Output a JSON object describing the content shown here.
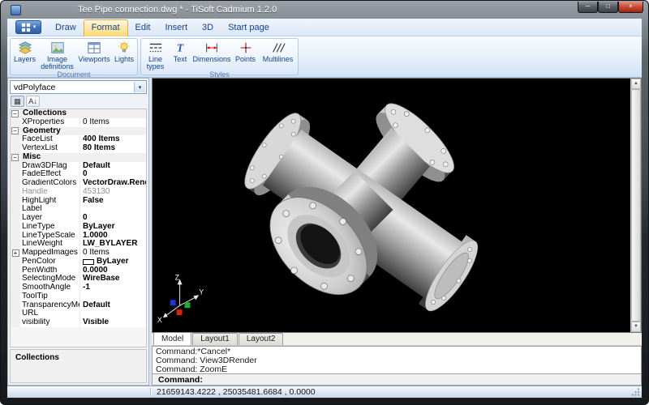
{
  "window": {
    "title": "Tee Pipe connection.dwg * - TiSoft Cadmium 1.2.0",
    "caption_buttons": {
      "minimize": "─",
      "maximize": "□",
      "close": "×"
    }
  },
  "icons": {
    "app_menu_arrow": "▾",
    "combo_arrow": "▾",
    "collapse_glyph": "−",
    "expand_glyph": "+",
    "scroll_up": "▲",
    "scroll_down": "▼",
    "categorized_tool": "▦",
    "alphabetical_tool": "A↓"
  },
  "ribbon": {
    "tabs": [
      {
        "label": "Draw"
      },
      {
        "label": "Format"
      },
      {
        "label": "Edit"
      },
      {
        "label": "Insert"
      },
      {
        "label": "3D"
      },
      {
        "label": "Start page"
      }
    ],
    "active_tab": "Format",
    "groups": [
      {
        "label": "Document",
        "buttons": [
          {
            "label": "Layers",
            "icon": "layers-icon"
          },
          {
            "label": "Image definitions",
            "icon": "image-definitions-icon"
          },
          {
            "label": "Viewports",
            "icon": "viewports-icon"
          },
          {
            "label": "Lights",
            "icon": "lights-icon"
          }
        ]
      },
      {
        "label": "Styles",
        "buttons": [
          {
            "label": "Line types",
            "icon": "line-types-icon"
          },
          {
            "label": "Text",
            "icon": "text-icon"
          },
          {
            "label": "Dimensions",
            "icon": "dimensions-icon"
          },
          {
            "label": "Points",
            "icon": "points-icon"
          },
          {
            "label": "Multilines",
            "icon": "multilines-icon"
          }
        ]
      }
    ]
  },
  "property_panel": {
    "selector_value": "vdPolyface",
    "rows": [
      {
        "type": "category",
        "label": "Collections"
      },
      {
        "name": "XProperties",
        "value": "0 Items"
      },
      {
        "type": "category",
        "label": "Geometry"
      },
      {
        "name": "FaceList",
        "value": "400 Items"
      },
      {
        "name": "VertexList",
        "value": "80 Items"
      },
      {
        "type": "category",
        "label": "Misc"
      },
      {
        "name": "Draw3DFlag",
        "value": "Default"
      },
      {
        "name": "FadeEffect",
        "value": "0"
      },
      {
        "name": "GradientColors",
        "value": "VectorDraw.Render.Ele"
      },
      {
        "name": "Handle",
        "value": "453130"
      },
      {
        "name": "HighLight",
        "value": "False"
      },
      {
        "name": "Label",
        "value": ""
      },
      {
        "name": "Layer",
        "value": "0"
      },
      {
        "name": "LineType",
        "value": "ByLayer"
      },
      {
        "name": "LineTypeScale",
        "value": "1.0000"
      },
      {
        "name": "LineWeight",
        "value": "LW_BYLAYER"
      },
      {
        "name": "MappedImages",
        "value": "0 Items"
      },
      {
        "name": "PenColor",
        "value": "ByLayer"
      },
      {
        "name": "PenWidth",
        "value": "0.0000"
      },
      {
        "name": "SelectingMode",
        "value": "WireBase"
      },
      {
        "name": "SmoothAngle",
        "value": "-1"
      },
      {
        "name": "ToolTip",
        "value": ""
      },
      {
        "name": "TransparencyMetho",
        "value": "Default"
      },
      {
        "name": "URL",
        "value": ""
      },
      {
        "name": "visibility",
        "value": "Visible"
      }
    ],
    "help_title": "Collections"
  },
  "viewport": {
    "background": "#000000",
    "axis": {
      "x_label": "X",
      "y_label": "Y",
      "z_label": "Z",
      "x_color": "#d62410",
      "y_color": "#1fae2e",
      "z_color": "#2433d6"
    }
  },
  "layout_tabs": [
    {
      "label": "Model"
    },
    {
      "label": "Layout1"
    },
    {
      "label": "Layout2"
    }
  ],
  "active_layout_tab": "Model",
  "command_window": {
    "history": [
      "Command:*Cancel*",
      "Command: View3DRender",
      "Command: ZoomE"
    ],
    "prompt_label": "Command:",
    "input_value": ""
  },
  "status_bar": {
    "coordinates": "21659143.4222 , 25035481.6684 , 0.0000"
  }
}
